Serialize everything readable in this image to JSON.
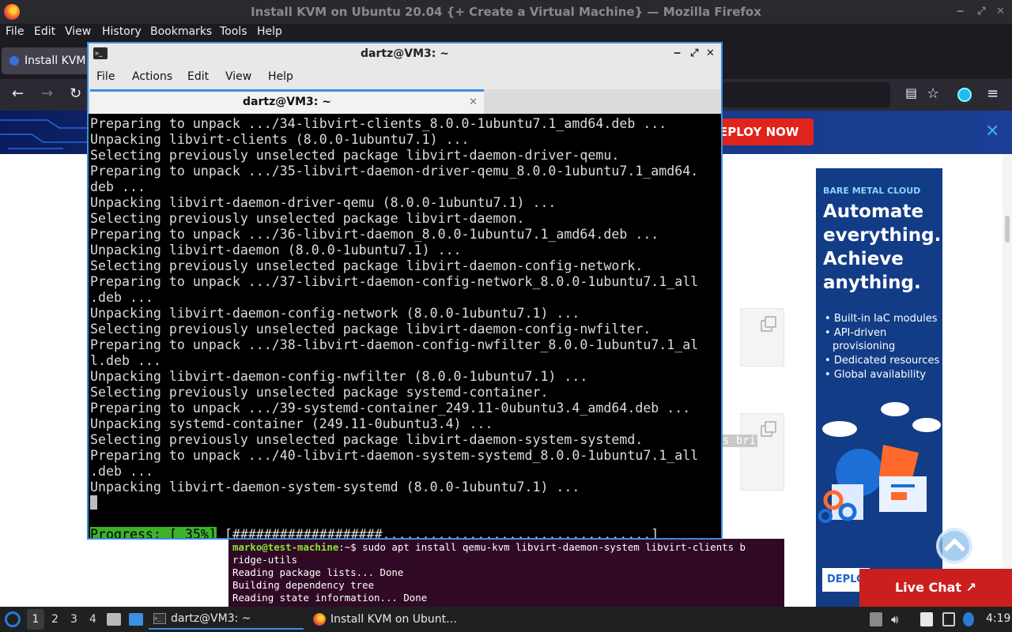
{
  "firefox": {
    "window_title": "Install KVM on Ubuntu 20.04 {+ Create a Virtual Machine} — Mozilla Firefox",
    "menu": [
      "File",
      "Edit",
      "View",
      "History",
      "Bookmarks",
      "Tools",
      "Help"
    ],
    "tab_title": "Install KVM",
    "nav": {
      "back": "←",
      "forward": "→",
      "reload": "↻",
      "reader": "▤",
      "bookmark": "☆",
      "menu": "≡"
    }
  },
  "page": {
    "banner": {
      "deploy_label": "EPLOY NOW",
      "close": "✕"
    },
    "code_snippet_fragment": "s bri",
    "ad": {
      "kicker": "BARE METAL CLOUD",
      "headline": [
        "Automate",
        "everything.",
        "Achieve",
        "anything."
      ],
      "bullets": [
        "Built-in IaC modules",
        "API-driven provisioning",
        "Dedicated resources",
        "Global availability"
      ],
      "deploy_label": "DEPLOY"
    },
    "live_chat": "Live Chat ↗",
    "bg_terminal": {
      "prompt_user": "marko@test-machine",
      "prompt_sep": ":~$ ",
      "command": "sudo apt install qemu-kvm libvirt-daemon-system libvirt-clients b",
      "lines": [
        "ridge-utils",
        "Reading package lists... Done",
        "Building dependency tree",
        "Reading state information... Done"
      ]
    }
  },
  "terminal": {
    "window_title": "dartz@VM3: ~",
    "tab_title": "dartz@VM3: ~",
    "controls": {
      "minimize": "‒",
      "maximize": "⤢",
      "close": "✕"
    },
    "menu": [
      "File",
      "Actions",
      "Edit",
      "View",
      "Help"
    ],
    "lines": [
      "Preparing to unpack .../34-libvirt-clients_8.0.0-1ubuntu7.1_amd64.deb ...",
      "Unpacking libvirt-clients (8.0.0-1ubuntu7.1) ...",
      "Selecting previously unselected package libvirt-daemon-driver-qemu.",
      "Preparing to unpack .../35-libvirt-daemon-driver-qemu_8.0.0-1ubuntu7.1_amd64.",
      "deb ...",
      "Unpacking libvirt-daemon-driver-qemu (8.0.0-1ubuntu7.1) ...",
      "Selecting previously unselected package libvirt-daemon.",
      "Preparing to unpack .../36-libvirt-daemon_8.0.0-1ubuntu7.1_amd64.deb ...",
      "Unpacking libvirt-daemon (8.0.0-1ubuntu7.1) ...",
      "Selecting previously unselected package libvirt-daemon-config-network.",
      "Preparing to unpack .../37-libvirt-daemon-config-network_8.0.0-1ubuntu7.1_all",
      ".deb ...",
      "Unpacking libvirt-daemon-config-network (8.0.0-1ubuntu7.1) ...",
      "Selecting previously unselected package libvirt-daemon-config-nwfilter.",
      "Preparing to unpack .../38-libvirt-daemon-config-nwfilter_8.0.0-1ubuntu7.1_al",
      "l.deb ...",
      "Unpacking libvirt-daemon-config-nwfilter (8.0.0-1ubuntu7.1) ...",
      "Selecting previously unselected package systemd-container.",
      "Preparing to unpack .../39-systemd-container_249.11-0ubuntu3.4_amd64.deb ...",
      "Unpacking systemd-container (249.11-0ubuntu3.4) ...",
      "Selecting previously unselected package libvirt-daemon-system-systemd.",
      "Preparing to unpack .../40-libvirt-daemon-system-systemd_8.0.0-1ubuntu7.1_all",
      ".deb ...",
      "Unpacking libvirt-daemon-system-systemd (8.0.0-1ubuntu7.1) ..."
    ],
    "progress": {
      "label": "Progress: [ 35%]",
      "bar": " [###################..................................]",
      "percent": 35
    }
  },
  "taskbar": {
    "workspaces": [
      "1",
      "2",
      "3",
      "4"
    ],
    "terminal_task": "dartz@VM3: ~",
    "firefox_task": "Install KVM on Ubunt…",
    "clock": "4:19"
  }
}
